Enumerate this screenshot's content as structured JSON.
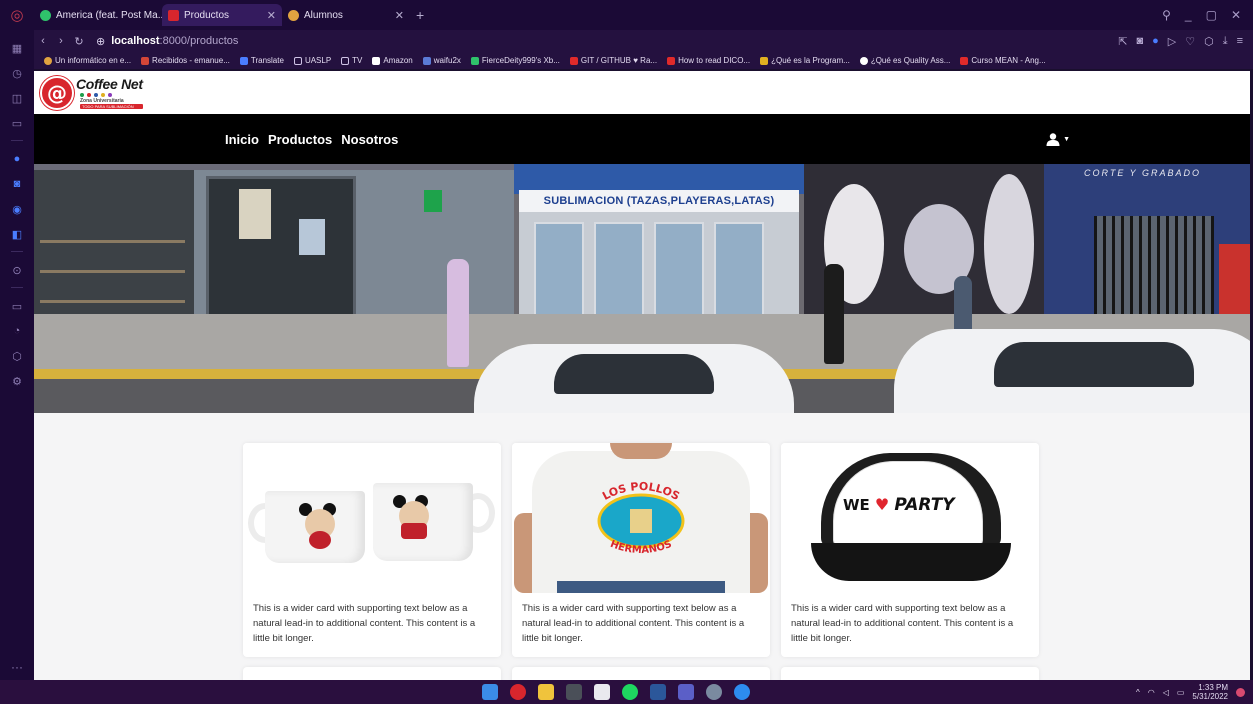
{
  "browser": {
    "tabs": [
      {
        "label": "America (feat. Post Ma...",
        "icon": "audio-icon",
        "active": false
      },
      {
        "label": "Productos",
        "icon": "coffeenet-favicon",
        "active": true
      },
      {
        "label": "Alumnos",
        "icon": "alumnos-favicon",
        "active": false
      }
    ],
    "url_host": "localhost",
    "url_path": ":8000/productos",
    "bookmarks": [
      "Un informático en e...",
      "Recibidos - emanue...",
      "Translate",
      "UASLP",
      "TV",
      "Amazon",
      "waifu2x",
      "FierceDeity999's Xb...",
      "GIT / GITHUB ♥ Ra...",
      "How to read DICO...",
      "¿Qué es la Program...",
      "¿Qué es Quality Ass...",
      "Curso MEAN - Ang..."
    ]
  },
  "site": {
    "logo_title": "Coffee Net",
    "logo_sub": "Zona Universitaria",
    "logo_sub2": "TODO PARA SUBLIMACIÓN",
    "nav": {
      "inicio": "Inicio",
      "productos": "Productos",
      "nosotros": "Nosotros"
    },
    "hero": {
      "shop_sign": "SUBLIMACION (TAZAS,PLAYERAS,LATAS)",
      "right_sign": "CORTE Y GRABADO"
    },
    "products": [
      {
        "text": "This is a wider card with supporting text below as a natural lead-in to additional content. This content is a little bit longer."
      },
      {
        "text": "This is a wider card with supporting text below as a natural lead-in to additional content. This content is a little bit longer.",
        "shirt_top": "LOS POLLOS",
        "shirt_bottom": "HERMANOS"
      },
      {
        "text": "This is a wider card with supporting text below as a natural lead-in to additional content. This content is a little bit longer.",
        "cap_we": "WE",
        "cap_party": "PARTY"
      }
    ]
  },
  "taskbar": {
    "time": "1:33 PM",
    "date": "5/31/2022"
  },
  "colors": {
    "accent": "#d8262d",
    "navbar": "#000000",
    "browser_bg": "#1b0a36"
  }
}
